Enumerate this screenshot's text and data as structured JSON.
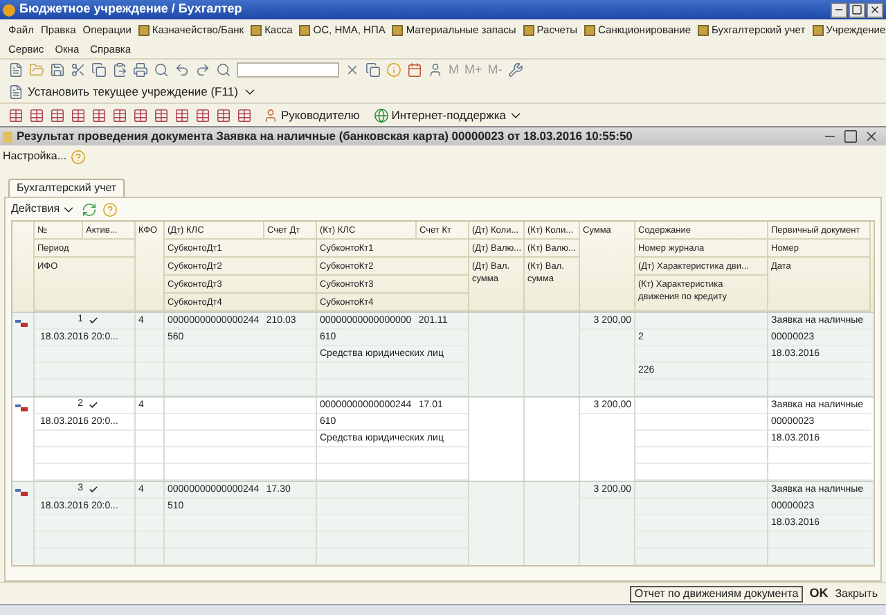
{
  "window": {
    "title": "Бюджетное учреждение / Бухгалтер"
  },
  "menu_row_1": [
    {
      "label": "Файл",
      "icon": false
    },
    {
      "label": "Правка",
      "icon": false
    },
    {
      "label": "Операции",
      "icon": false
    },
    {
      "label": "Казначейство/Банк",
      "icon": true
    },
    {
      "label": "Касса",
      "icon": true
    },
    {
      "label": "ОС, НМА, НПА",
      "icon": true
    },
    {
      "label": "Материальные запасы",
      "icon": true
    },
    {
      "label": "Расчеты",
      "icon": true
    },
    {
      "label": "Санкционирование",
      "icon": true
    },
    {
      "label": "Бухгалтерский учет",
      "icon": true
    },
    {
      "label": "Учреждение",
      "icon": true
    }
  ],
  "menu_row_2": [
    {
      "label": "Сервис"
    },
    {
      "label": "Окна"
    },
    {
      "label": "Справка"
    }
  ],
  "toolbar": {
    "memory_buttons": [
      "M",
      "M+",
      "M-"
    ]
  },
  "institution_button": "Установить текущее учреждение (F11)",
  "toolbar_3": {
    "manager_button": "Руководителю",
    "support_button": "Интернет-поддержка"
  },
  "document_window": {
    "title": "Результат проведения документа Заявка на наличные (банковская карта) 00000023 от 18.03.2016 10:55:50",
    "settings_link": "Настройка...",
    "tabs": [
      {
        "label": "Бухгалтерский учет",
        "selected": true
      }
    ],
    "actions_button": "Действия",
    "table": {
      "header": {
        "number": "№",
        "active": "Актив...",
        "kfo": "КФО",
        "dt_kls": "(Дт) КЛС",
        "dt_account": "Счет Дт",
        "kt_kls": "(Кт) КЛС",
        "kt_account": "Счет Кт",
        "dt_qty": "(Дт) Коли...",
        "kt_qty": "(Кт) Коли...",
        "amount": "Сумма",
        "content": "Содержание",
        "document": "Первичный документ",
        "period": "Период",
        "ifo": "ИФО",
        "dt_subkonto": [
          "СубконтоДт1",
          "СубконтоДт2",
          "СубконтоДт3",
          "СубконтоДт4"
        ],
        "kt_subkonto": [
          "СубконтоКт1",
          "СубконтоКт2",
          "СубконтоКт3",
          "СубконтоКт4"
        ],
        "dt_currency": "(Дт) Валю...",
        "kt_currency": "(Кт) Валю...",
        "dt_currency_sum": "(Дт) Вал. сумма",
        "kt_currency_sum": "(Кт) Вал. сумма",
        "journal_number": "Номер журнала",
        "dt_characteristic": "(Дт) Характеристика дви...",
        "kt_characteristic": "(Кт) Характеристика движения по кредиту",
        "doc_number": "Номер",
        "doc_date": "Дата"
      },
      "rows": [
        {
          "number": "1",
          "active": true,
          "period": "18.03.2016 20:0...",
          "kfo": "4",
          "dt_kls": "00000000000000244",
          "dt_account": "210.03",
          "dt_subkonto": [
            "560"
          ],
          "kt_kls": "00000000000000000",
          "kt_account": "201.11",
          "kt_subkonto": [
            "610",
            "Средства юридических лиц"
          ],
          "amount": "3 200,00",
          "journal_number": "2",
          "kt_characteristic": "226",
          "document": [
            "Заявка на наличные",
            "00000023",
            "18.03.2016"
          ]
        },
        {
          "number": "2",
          "active": true,
          "period": "18.03.2016 20:0...",
          "kfo": "4",
          "kt_kls": "00000000000000244",
          "kt_account": "17.01",
          "kt_subkonto": [
            "610",
            "Средства юридических лиц"
          ],
          "amount": "3 200,00",
          "document": [
            "Заявка на наличные",
            "00000023",
            "18.03.2016"
          ]
        },
        {
          "number": "3",
          "active": true,
          "period": "18.03.2016 20:0...",
          "kfo": "4",
          "dt_kls": "00000000000000244",
          "dt_account": "17.30",
          "dt_subkonto": [
            "510"
          ],
          "amount": "3 200,00",
          "document": [
            "Заявка на наличные",
            "00000023",
            "18.03.2016"
          ]
        }
      ]
    },
    "footer": {
      "report_button": "Отчет по движениям документа",
      "ok_button": "OK",
      "close_button": "Закрыть"
    }
  }
}
